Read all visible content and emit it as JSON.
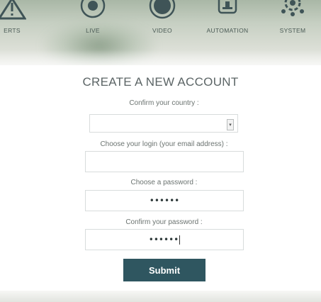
{
  "nav": {
    "items": [
      {
        "label": "ERTS",
        "icon": "alert-icon"
      },
      {
        "label": "LIVE",
        "icon": "live-icon"
      },
      {
        "label": "VIDEO",
        "icon": "video-icon"
      },
      {
        "label": "AUTOMATION",
        "icon": "automation-icon"
      },
      {
        "label": "SYSTEM",
        "icon": "system-icon"
      }
    ]
  },
  "form": {
    "title": "CREATE A NEW ACCOUNT",
    "country_label": "Confirm your country :",
    "country_value": "",
    "login_label": "Choose your login (your email address) :",
    "login_value": "",
    "password_label": "Choose a password :",
    "password_value": "••••••",
    "confirm_label": "Confirm your password :",
    "confirm_value": "••••••",
    "submit_label": "Submit"
  },
  "colors": {
    "submit_bg": "#2f5660",
    "nav_icon": "#3f5457"
  }
}
